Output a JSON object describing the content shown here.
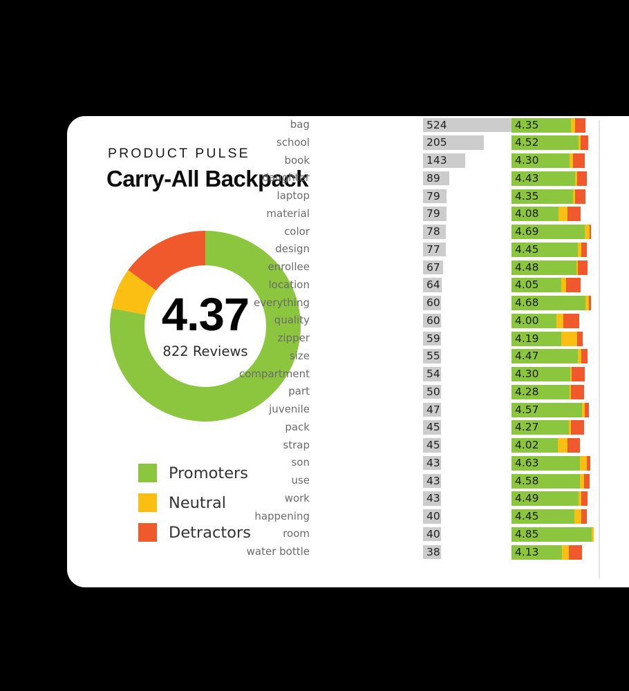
{
  "card": {
    "eyebrow": "PRODUCT PULSE",
    "title": "Carry-All Backpack"
  },
  "colors": {
    "promoters": "#8CC63F",
    "neutral": "#FBBF13",
    "detractors": "#F0592B",
    "count_bar": "#CCCCCC",
    "grid_line": "#E2E2E2",
    "card_bg": "#FFFFFF",
    "page_bg": "#000000"
  },
  "summary": {
    "score": "4.37",
    "reviews_label": "822 Reviews",
    "reviews_count": 822
  },
  "legend": [
    {
      "label": "Promoters",
      "color": "#8CC63F"
    },
    {
      "label": "Neutral",
      "color": "#FBBF13"
    },
    {
      "label": "Detractors",
      "color": "#F0592B"
    }
  ],
  "chart_data": {
    "type": "bar",
    "title": "Carry-All Backpack",
    "subtitle": "PRODUCT PULSE",
    "xlabel": "",
    "ylabel": "",
    "grid": true,
    "legend_position": "left-bottom",
    "donut": {
      "type": "pie",
      "center_value": "4.37",
      "center_sublabel": "822 Reviews",
      "categories": [
        "Promoters",
        "Neutral",
        "Detractors"
      ],
      "values": [
        78,
        7,
        15
      ],
      "colors": [
        "#8CC63F",
        "#FBBF13",
        "#F0592B"
      ],
      "start_angle_deg": 0,
      "direction": "clockwise"
    },
    "columns": [
      "term",
      "mentions",
      "rating"
    ],
    "count_max": 524,
    "rating_max": 5.0,
    "categories": [
      "bag",
      "school",
      "book",
      "daughter",
      "laptop",
      "material",
      "color",
      "design",
      "enrollee",
      "location",
      "everything",
      "quality",
      "zipper",
      "size",
      "compartment",
      "part",
      "juvenile",
      "pack",
      "strap",
      "son",
      "use",
      "work",
      "happening",
      "room",
      "water bottle"
    ],
    "series": [
      {
        "name": "mentions",
        "values": [
          524,
          205,
          143,
          89,
          79,
          79,
          78,
          77,
          67,
          64,
          60,
          60,
          59,
          55,
          54,
          50,
          47,
          45,
          45,
          43,
          43,
          43,
          40,
          40,
          38
        ]
      },
      {
        "name": "rating",
        "values": [
          4.35,
          4.52,
          4.3,
          4.43,
          4.35,
          4.08,
          4.69,
          4.45,
          4.48,
          4.05,
          4.68,
          4.0,
          4.19,
          4.47,
          4.3,
          4.28,
          4.57,
          4.27,
          4.02,
          4.63,
          4.58,
          4.49,
          4.45,
          4.85,
          4.13
        ]
      }
    ],
    "rows": [
      {
        "term": "bag",
        "count": 524,
        "rating": "4.35",
        "promoters": 80,
        "neutral": 6,
        "detractors": 14
      },
      {
        "term": "school",
        "count": 205,
        "rating": "4.52",
        "promoters": 87,
        "neutral": 3,
        "detractors": 10
      },
      {
        "term": "book",
        "count": 143,
        "rating": "4.30",
        "promoters": 79,
        "neutral": 5,
        "detractors": 16
      },
      {
        "term": "daughter",
        "count": 89,
        "rating": "4.43",
        "promoters": 84,
        "neutral": 3,
        "detractors": 13
      },
      {
        "term": "laptop",
        "count": 79,
        "rating": "4.35",
        "promoters": 83,
        "neutral": 3,
        "detractors": 14
      },
      {
        "term": "material",
        "count": 79,
        "rating": "4.08",
        "promoters": 68,
        "neutral": 13,
        "detractors": 19
      },
      {
        "term": "color",
        "count": 78,
        "rating": "4.69",
        "promoters": 92,
        "neutral": 6,
        "detractors": 2
      },
      {
        "term": "design",
        "count": 77,
        "rating": "4.45",
        "promoters": 88,
        "neutral": 4,
        "detractors": 8
      },
      {
        "term": "enrollee",
        "count": 67,
        "rating": "4.48",
        "promoters": 85,
        "neutral": 2,
        "detractors": 13
      },
      {
        "term": "location",
        "count": 64,
        "rating": "4.05",
        "promoters": 72,
        "neutral": 7,
        "detractors": 21
      },
      {
        "term": "everything",
        "count": 60,
        "rating": "4.68",
        "promoters": 93,
        "neutral": 4,
        "detractors": 3
      },
      {
        "term": "quality",
        "count": 60,
        "rating": "4.00",
        "promoters": 66,
        "neutral": 10,
        "detractors": 24
      },
      {
        "term": "zipper",
        "count": 59,
        "rating": "4.19",
        "promoters": 70,
        "neutral": 22,
        "detractors": 8
      },
      {
        "term": "size",
        "count": 55,
        "rating": "4.47",
        "promoters": 87,
        "neutral": 5,
        "detractors": 8
      },
      {
        "term": "compartment",
        "count": 54,
        "rating": "4.30",
        "promoters": 80,
        "neutral": 2,
        "detractors": 18
      },
      {
        "term": "part",
        "count": 50,
        "rating": "4.28",
        "promoters": 80,
        "neutral": 2,
        "detractors": 18
      },
      {
        "term": "juvenile",
        "count": 47,
        "rating": "4.57",
        "promoters": 91,
        "neutral": 3,
        "detractors": 6
      },
      {
        "term": "pack",
        "count": 45,
        "rating": "4.27",
        "promoters": 79,
        "neutral": 3,
        "detractors": 18
      },
      {
        "term": "strap",
        "count": 45,
        "rating": "4.02",
        "promoters": 68,
        "neutral": 14,
        "detractors": 18
      },
      {
        "term": "son",
        "count": 43,
        "rating": "4.63",
        "promoters": 87,
        "neutral": 9,
        "detractors": 4
      },
      {
        "term": "use",
        "count": 43,
        "rating": "4.58",
        "promoters": 88,
        "neutral": 5,
        "detractors": 7
      },
      {
        "term": "work",
        "count": 43,
        "rating": "4.49",
        "promoters": 88,
        "neutral": 3,
        "detractors": 9
      },
      {
        "term": "happening",
        "count": 40,
        "rating": "4.45",
        "promoters": 83,
        "neutral": 9,
        "detractors": 8
      },
      {
        "term": "room",
        "count": 40,
        "rating": "4.85",
        "promoters": 97,
        "neutral": 3,
        "detractors": 0
      },
      {
        "term": "water bottle",
        "count": 38,
        "rating": "4.13",
        "promoters": 72,
        "neutral": 10,
        "detractors": 18
      }
    ]
  }
}
